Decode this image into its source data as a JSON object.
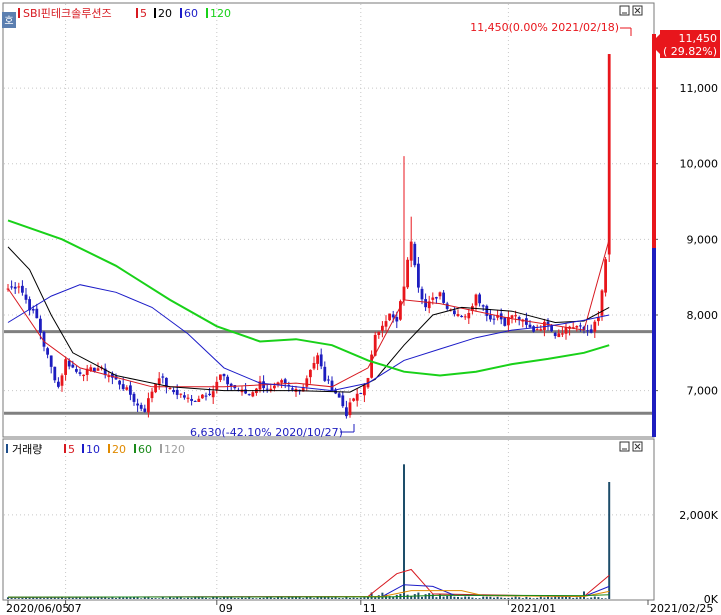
{
  "header": {
    "stock_name": "SBI핀테크솔루션즈",
    "legend": [
      {
        "label": "5",
        "color": "#d71920"
      },
      {
        "label": "20",
        "color": "#000000"
      },
      {
        "label": "60",
        "color": "#1c1cc8"
      },
      {
        "label": "120",
        "color": "#19d119"
      }
    ],
    "corner_icon": "settings-badge-icon"
  },
  "volume_header": {
    "title": "거래량",
    "legend": [
      {
        "label": "5",
        "color": "#d71920"
      },
      {
        "label": "10",
        "color": "#1c1cc8"
      },
      {
        "label": "20",
        "color": "#e08a00"
      },
      {
        "label": "60",
        "color": "#1a8a1a"
      },
      {
        "label": "120",
        "color": "#a0a0a0"
      }
    ]
  },
  "annotations": {
    "high": "11,450(0.00% 2021/02/18)",
    "low": "6,630(-42.10% 2020/10/27)",
    "last_price": "11,450",
    "last_change": "( 29.82%)"
  },
  "colors": {
    "up": "#e8161c",
    "down": "#1d1dbf",
    "ma5": "#d71920",
    "ma20": "#000000",
    "ma60": "#1c1cc8",
    "ma120": "#19d119",
    "hline": "#808080",
    "grid": "#c8c8c8",
    "label_box": "#e8161c"
  },
  "chart_data": {
    "type": "candlestick",
    "price_ylim": [
      6400,
      11900
    ],
    "price_ticks": [
      {
        "v": 7000,
        "label": "7,000"
      },
      {
        "v": 8000,
        "label": "8,000"
      },
      {
        "v": 9000,
        "label": "9,000"
      },
      {
        "v": 10000,
        "label": "10,000"
      },
      {
        "v": 11000,
        "label": "11,000"
      }
    ],
    "volume_ticks": [
      {
        "v": 0,
        "label": "0K"
      },
      {
        "v": 2000,
        "label": "2,000K"
      }
    ],
    "volume_ylim": [
      0,
      3350
    ],
    "x_labels": [
      {
        "i": 0,
        "label": "2020/06/05"
      },
      {
        "i": 16,
        "label": "07"
      },
      {
        "i": 58,
        "label": "09"
      },
      {
        "i": 98,
        "label": "11"
      },
      {
        "i": 139,
        "label": "2021/01"
      },
      {
        "i": 171,
        "label": "2021/02/25"
      }
    ],
    "grid_x": [
      16,
      58,
      98,
      139
    ],
    "horizontal_lines": [
      7780,
      6700
    ],
    "anchors": [
      [
        0,
        8350
      ],
      [
        3,
        8400
      ],
      [
        6,
        8100
      ],
      [
        8,
        7950
      ],
      [
        10,
        7600
      ],
      [
        12,
        7300
      ],
      [
        14,
        7050
      ],
      [
        16,
        7400
      ],
      [
        19,
        7250
      ],
      [
        22,
        7250
      ],
      [
        25,
        7300
      ],
      [
        28,
        7200
      ],
      [
        31,
        7100
      ],
      [
        34,
        6950
      ],
      [
        36,
        6800
      ],
      [
        38,
        6750
      ],
      [
        40,
        7000
      ],
      [
        42,
        7200
      ],
      [
        45,
        7000
      ],
      [
        48,
        6950
      ],
      [
        51,
        6850
      ],
      [
        54,
        6950
      ],
      [
        57,
        7000
      ],
      [
        59,
        7200
      ],
      [
        61,
        7100
      ],
      [
        64,
        7000
      ],
      [
        67,
        6950
      ],
      [
        70,
        7100
      ],
      [
        73,
        7000
      ],
      [
        76,
        7100
      ],
      [
        79,
        7000
      ],
      [
        82,
        7050
      ],
      [
        84,
        7300
      ],
      [
        86,
        7450
      ],
      [
        88,
        7150
      ],
      [
        90,
        7050
      ],
      [
        92,
        6900
      ],
      [
        94,
        6700
      ],
      [
        96,
        6900
      ],
      [
        98,
        6950
      ],
      [
        100,
        7200
      ],
      [
        102,
        7700
      ],
      [
        104,
        7900
      ],
      [
        106,
        8000
      ],
      [
        108,
        7900
      ],
      [
        110,
        8400
      ],
      [
        112,
        9000
      ],
      [
        114,
        8400
      ],
      [
        116,
        8100
      ],
      [
        118,
        8200
      ],
      [
        120,
        8300
      ],
      [
        122,
        8100
      ],
      [
        124,
        8050
      ],
      [
        126,
        8000
      ],
      [
        128,
        8000
      ],
      [
        130,
        8300
      ],
      [
        132,
        8100
      ],
      [
        134,
        7950
      ],
      [
        136,
        8000
      ],
      [
        138,
        7900
      ],
      [
        140,
        8000
      ],
      [
        142,
        7950
      ],
      [
        144,
        7850
      ],
      [
        146,
        7800
      ],
      [
        148,
        7850
      ],
      [
        150,
        7900
      ],
      [
        152,
        7750
      ],
      [
        154,
        7800
      ],
      [
        156,
        7850
      ],
      [
        158,
        7850
      ],
      [
        160,
        7800
      ],
      [
        162,
        7800
      ],
      [
        164,
        7950
      ],
      [
        166,
        8700
      ],
      [
        167,
        11450
      ]
    ],
    "ma_lines": [
      {
        "name": "5",
        "points": [
          [
            0,
            8350
          ],
          [
            10,
            7650
          ],
          [
            20,
            7300
          ],
          [
            40,
            7050
          ],
          [
            60,
            7050
          ],
          [
            80,
            7100
          ],
          [
            90,
            7050
          ],
          [
            100,
            7300
          ],
          [
            110,
            8200
          ],
          [
            120,
            8150
          ],
          [
            140,
            7950
          ],
          [
            160,
            7800
          ],
          [
            167,
            9000
          ]
        ]
      },
      {
        "name": "20",
        "points": [
          [
            0,
            8900
          ],
          [
            6,
            8600
          ],
          [
            12,
            8000
          ],
          [
            18,
            7500
          ],
          [
            30,
            7200
          ],
          [
            45,
            7050
          ],
          [
            60,
            7000
          ],
          [
            80,
            7000
          ],
          [
            95,
            6980
          ],
          [
            102,
            7150
          ],
          [
            110,
            7600
          ],
          [
            118,
            8000
          ],
          [
            126,
            8100
          ],
          [
            140,
            8050
          ],
          [
            152,
            7900
          ],
          [
            160,
            7920
          ],
          [
            167,
            8100
          ]
        ]
      },
      {
        "name": "60",
        "points": [
          [
            0,
            7900
          ],
          [
            12,
            8250
          ],
          [
            20,
            8400
          ],
          [
            30,
            8300
          ],
          [
            40,
            8100
          ],
          [
            50,
            7750
          ],
          [
            60,
            7300
          ],
          [
            70,
            7100
          ],
          [
            80,
            7050
          ],
          [
            90,
            7000
          ],
          [
            100,
            7100
          ],
          [
            110,
            7400
          ],
          [
            120,
            7550
          ],
          [
            130,
            7700
          ],
          [
            140,
            7800
          ],
          [
            150,
            7850
          ],
          [
            160,
            7930
          ],
          [
            167,
            8000
          ]
        ]
      },
      {
        "name": "120",
        "points": [
          [
            0,
            9250
          ],
          [
            15,
            9000
          ],
          [
            30,
            8650
          ],
          [
            45,
            8200
          ],
          [
            58,
            7850
          ],
          [
            70,
            7650
          ],
          [
            80,
            7680
          ],
          [
            90,
            7600
          ],
          [
            100,
            7400
          ],
          [
            110,
            7250
          ],
          [
            120,
            7200
          ],
          [
            130,
            7250
          ],
          [
            140,
            7350
          ],
          [
            150,
            7420
          ],
          [
            160,
            7500
          ],
          [
            167,
            7600
          ]
        ]
      }
    ],
    "volume_spikes": [
      [
        110,
        3200
      ],
      [
        167,
        2780
      ],
      [
        160,
        180
      ],
      [
        104,
        150
      ]
    ]
  }
}
